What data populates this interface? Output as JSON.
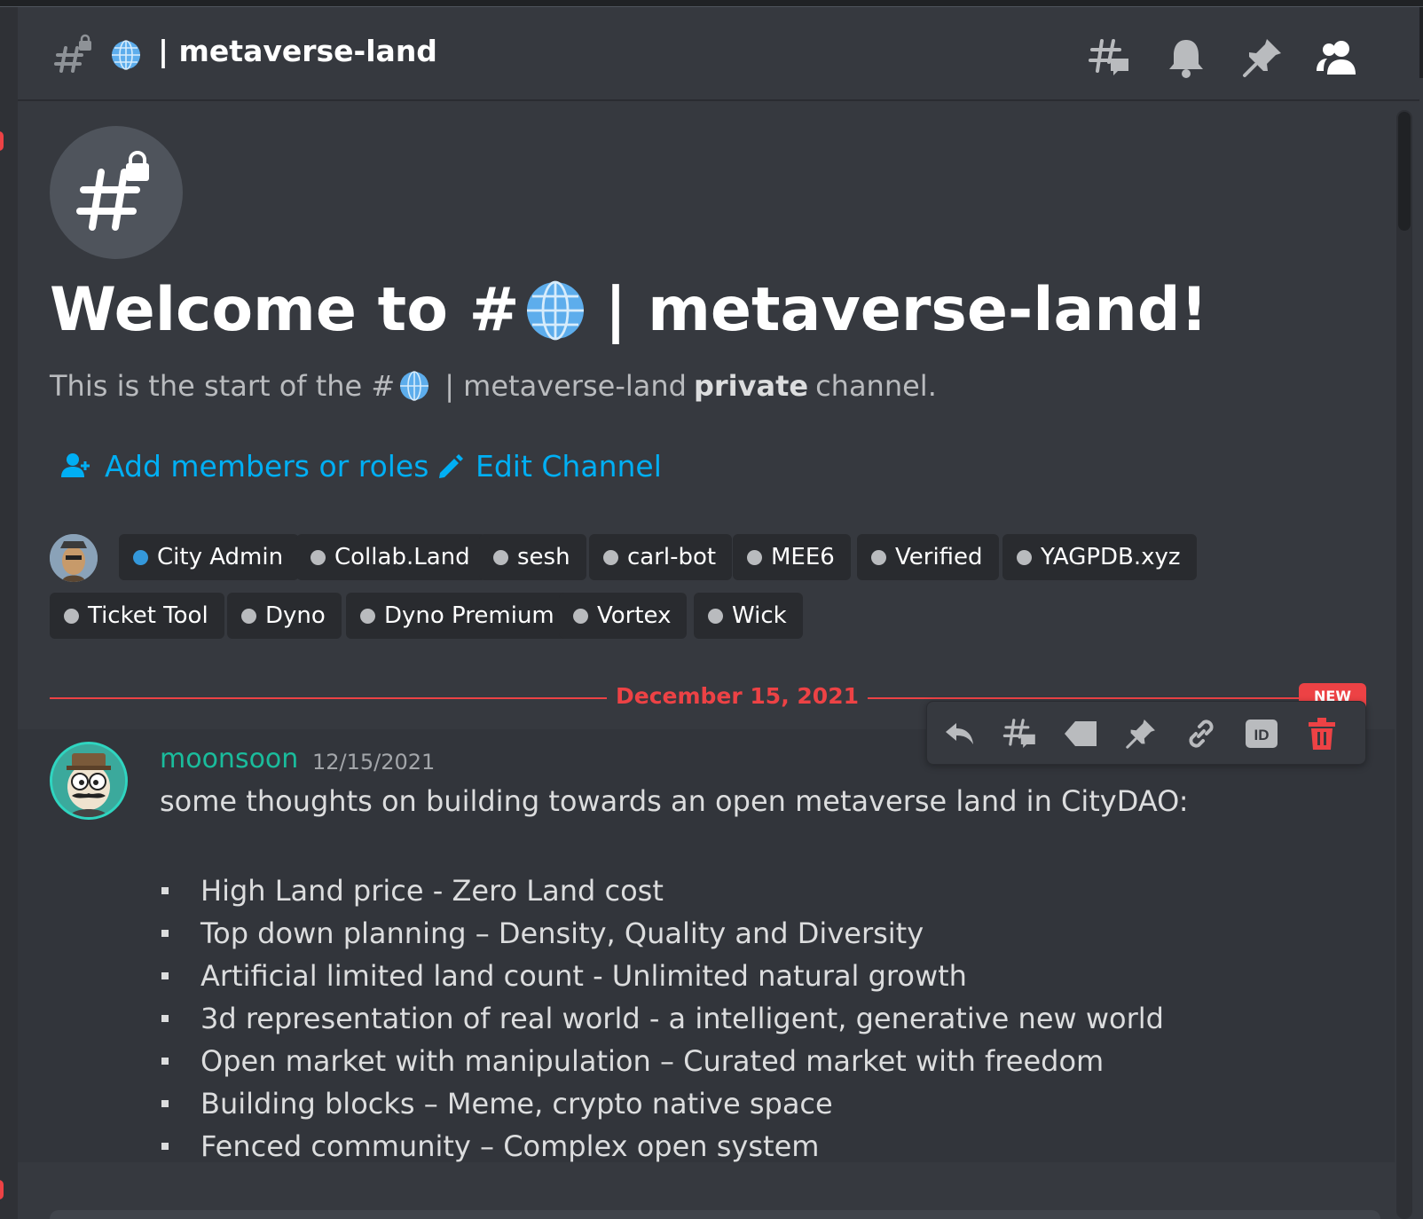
{
  "header": {
    "channel_name": "| metaverse-land",
    "toolbar": [
      "threads-icon",
      "bell-icon",
      "pin-icon",
      "members-icon"
    ]
  },
  "welcome": {
    "heading_prefix": "Welcome to #",
    "heading_suffix": "| metaverse-land!",
    "subtitle_prefix": "This is the start of the #",
    "subtitle_mid": "| metaverse-land",
    "subtitle_bold": "private",
    "subtitle_suffix": "channel.",
    "add_members_label": "Add members or roles",
    "edit_channel_label": "Edit Channel"
  },
  "roles": [
    {
      "label": "City Admin",
      "color": "#3498db"
    },
    {
      "label": "Collab.Land",
      "color": "#b9bbbe"
    },
    {
      "label": "sesh",
      "color": "#b9bbbe"
    },
    {
      "label": "carl-bot",
      "color": "#b9bbbe"
    },
    {
      "label": "MEE6",
      "color": "#b9bbbe"
    },
    {
      "label": "Verified",
      "color": "#b9bbbe"
    },
    {
      "label": "YAGPDB.xyz",
      "color": "#b9bbbe"
    },
    {
      "label": "Ticket Tool",
      "color": "#b9bbbe"
    },
    {
      "label": "Dyno",
      "color": "#b9bbbe"
    },
    {
      "label": "Dyno Premium",
      "color": "#b9bbbe"
    },
    {
      "label": "Vortex",
      "color": "#b9bbbe"
    },
    {
      "label": "Wick",
      "color": "#b9bbbe"
    }
  ],
  "divider": {
    "date": "December 15, 2021",
    "new_badge": "NEW"
  },
  "message": {
    "author": "moonsoon",
    "author_color": "#1abc9c",
    "timestamp": "12/15/2021",
    "intro": "some thoughts on building towards an open metaverse land in CityDAO:",
    "bullets": [
      "High Land price - Zero Land cost",
      "Top down planning – Density, Quality and Diversity",
      "Artificial limited land count - Unlimited natural growth",
      "3d representation of real world  -  a intelligent, generative new world",
      "Open market with manipulation – Curated market with freedom",
      "Building blocks – Meme, crypto native space",
      "Fenced community – Complex open system"
    ]
  },
  "message_toolbar": [
    "reply-icon",
    "thread-icon",
    "tag-icon",
    "pin-icon",
    "link-icon",
    "id-icon",
    "delete-icon"
  ],
  "colors": {
    "background": "#36393f",
    "link": "#00aff4",
    "danger": "#ed4245"
  }
}
